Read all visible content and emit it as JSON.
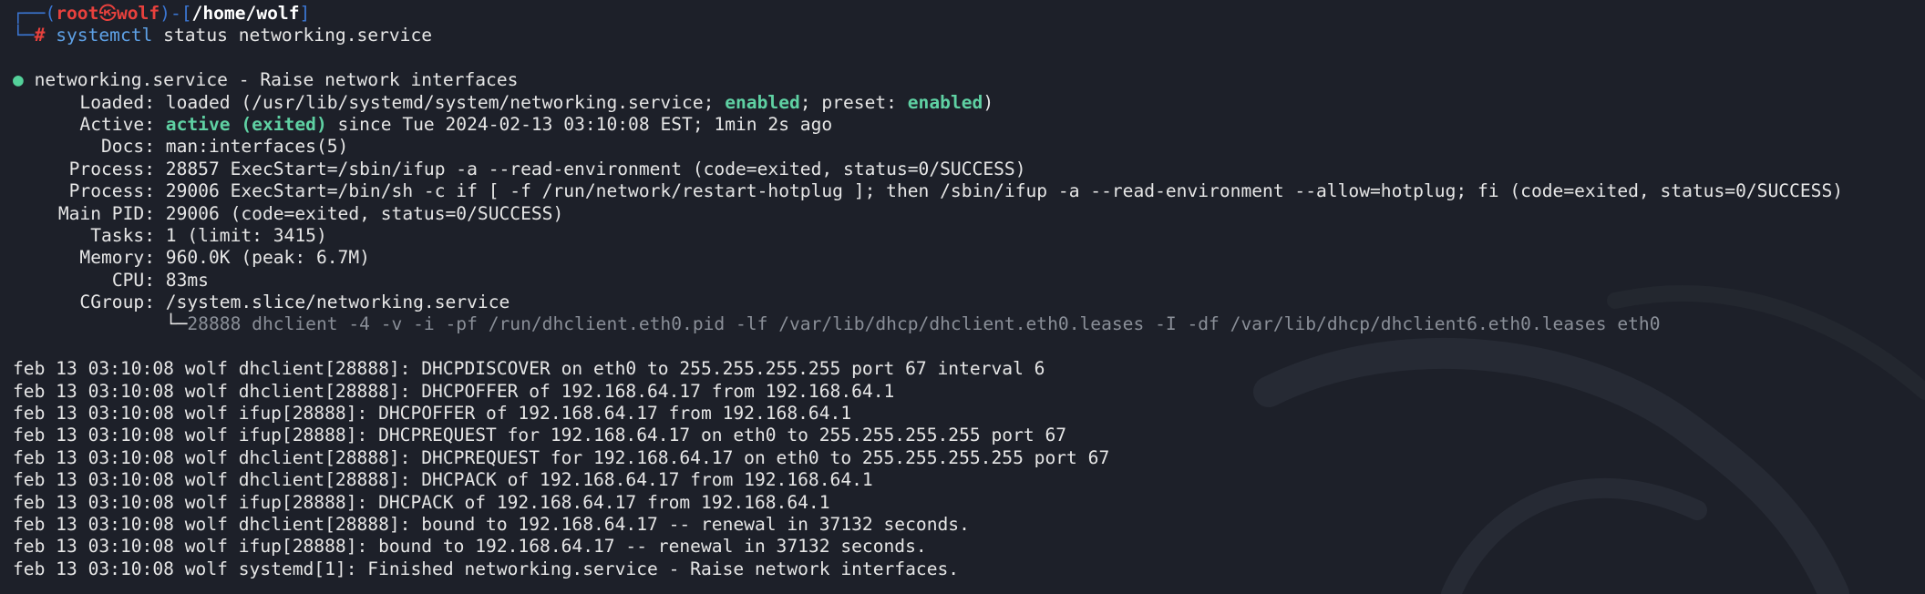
{
  "prompt": {
    "top_open": "┌──(",
    "user": "root",
    "skull": "㉿",
    "host": "wolf",
    "top_mid": ")-[",
    "path": "/home/wolf",
    "top_close": "]",
    "bottom_corner": "└─",
    "hash": "#",
    "command_name": "systemctl",
    "command_args": " status networking.service"
  },
  "service": {
    "dot": "●",
    "header": " networking.service - Raise network interfaces",
    "loaded_label": "Loaded:",
    "loaded_prefix": " loaded (/usr/lib/systemd/system/networking.service; ",
    "loaded_enabled": "enabled",
    "loaded_mid": "; preset: ",
    "loaded_preset": "enabled",
    "loaded_suffix": ")",
    "active_label": "Active:",
    "active_state": "active (exited)",
    "active_rest": " since Tue 2024-02-13 03:10:08 EST; 1min 2s ago",
    "docs_label": "Docs:",
    "docs_value": " man:interfaces(5)",
    "process1_label": "Process:",
    "process1_value": " 28857 ExecStart=/sbin/ifup -a --read-environment (code=exited, status=0/SUCCESS)",
    "process2_label": "Process:",
    "process2_value": " 29006 ExecStart=/bin/sh -c if [ -f /run/network/restart-hotplug ]; then /sbin/ifup -a --read-environment --allow=hotplug; fi (code=exited, status=0/SUCCESS)",
    "mainpid_label": "Main PID:",
    "mainpid_value": " 29006 (code=exited, status=0/SUCCESS)",
    "tasks_label": "Tasks:",
    "tasks_value": " 1 (limit: 3415)",
    "memory_label": "Memory:",
    "memory_value": " 960.0K (peak: 6.7M)",
    "cpu_label": "CPU:",
    "cpu_value": " 83ms",
    "cgroup_label": "CGroup:",
    "cgroup_value": " /system.slice/networking.service",
    "cgroup_tree": "└─",
    "cgroup_child": "28888 dhclient -4 -v -i -pf /run/dhclient.eth0.pid -lf /var/lib/dhcp/dhclient.eth0.leases -I -df /var/lib/dhcp/dhclient6.eth0.leases eth0"
  },
  "log_lines": [
    "feb 13 03:10:08 wolf dhclient[28888]: DHCPDISCOVER on eth0 to 255.255.255.255 port 67 interval 6",
    "feb 13 03:10:08 wolf dhclient[28888]: DHCPOFFER of 192.168.64.17 from 192.168.64.1",
    "feb 13 03:10:08 wolf ifup[28888]: DHCPOFFER of 192.168.64.17 from 192.168.64.1",
    "feb 13 03:10:08 wolf ifup[28888]: DHCPREQUEST for 192.168.64.17 on eth0 to 255.255.255.255 port 67",
    "feb 13 03:10:08 wolf dhclient[28888]: DHCPREQUEST for 192.168.64.17 on eth0 to 255.255.255.255 port 67",
    "feb 13 03:10:08 wolf dhclient[28888]: DHCPACK of 192.168.64.17 from 192.168.64.1",
    "feb 13 03:10:08 wolf ifup[28888]: DHCPACK of 192.168.64.17 from 192.168.64.1",
    "feb 13 03:10:08 wolf dhclient[28888]: bound to 192.168.64.17 -- renewal in 37132 seconds.",
    "feb 13 03:10:08 wolf ifup[28888]: bound to 192.168.64.17 -- renewal in 37132 seconds.",
    "feb 13 03:10:08 wolf systemd[1]: Finished networking.service - Raise network interfaces."
  ],
  "colors": {
    "background": "#1d2029",
    "prompt_box": "#3b76d2",
    "root_red": "#e8413d",
    "command_blue": "#5ea1e6",
    "status_green": "#5fd1a3",
    "dim_gray": "#8a8f98"
  }
}
